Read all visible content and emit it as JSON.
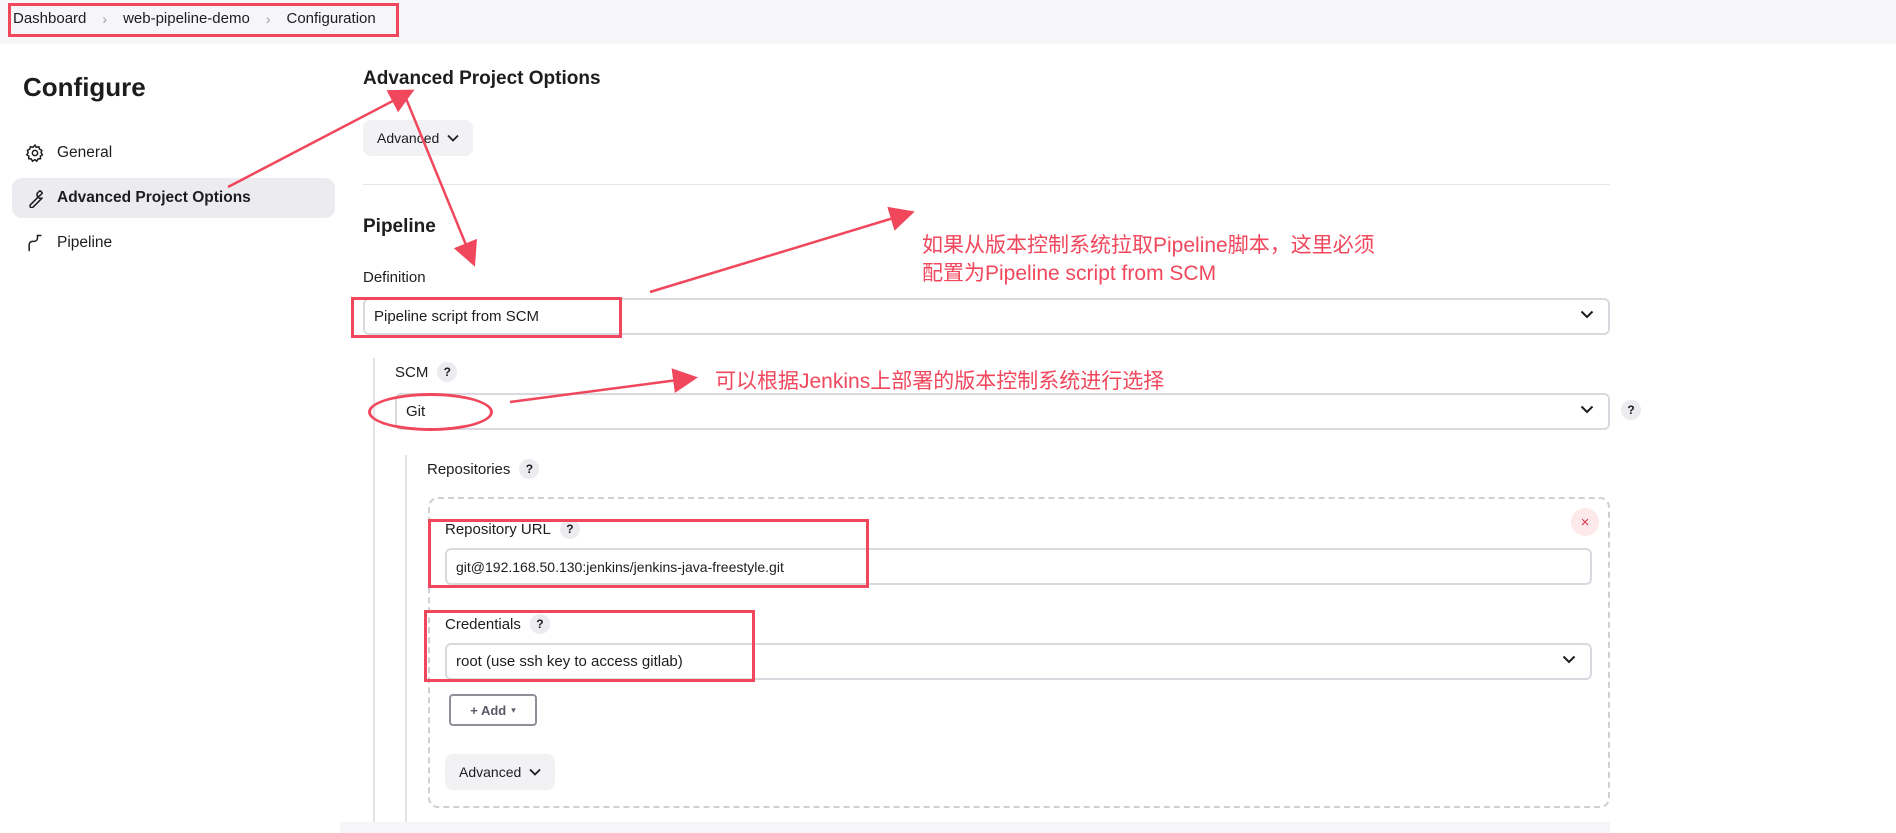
{
  "breadcrumb": {
    "items": [
      "Dashboard",
      "web-pipeline-demo",
      "Configuration"
    ]
  },
  "sidebar": {
    "title": "Configure",
    "items": [
      {
        "label": "General",
        "icon": "gear-icon"
      },
      {
        "label": "Advanced Project Options",
        "icon": "wrench-icon"
      },
      {
        "label": "Pipeline",
        "icon": "pipeline-icon"
      }
    ]
  },
  "advanced_project_options": {
    "heading": "Advanced Project Options",
    "advanced_button": "Advanced"
  },
  "pipeline": {
    "heading": "Pipeline",
    "definition_label": "Definition",
    "definition_value": "Pipeline script from SCM",
    "scm_label": "SCM",
    "scm_value": "Git",
    "repositories_label": "Repositories",
    "repository_url_label": "Repository URL",
    "repository_url_value": "git@192.168.50.130:jenkins/jenkins-java-freestyle.git",
    "credentials_label": "Credentials",
    "credentials_value": "root (use ssh key to access gitlab)",
    "add_button": "+ Add",
    "advanced_button": "Advanced",
    "help_glyph": "?",
    "delete_glyph": "×"
  },
  "annotations": {
    "note1_line1": "如果从版本控制系统拉取Pipeline脚本，这里必须",
    "note1_line2": "配置为Pipeline script from SCM",
    "note2": "可以根据Jenkins上部署的版本控制系统进行选择"
  },
  "colors": {
    "annotation_red": "#f0475c",
    "active_item_bg": "#ececf0",
    "topbar_bg": "#f6f6f8"
  }
}
